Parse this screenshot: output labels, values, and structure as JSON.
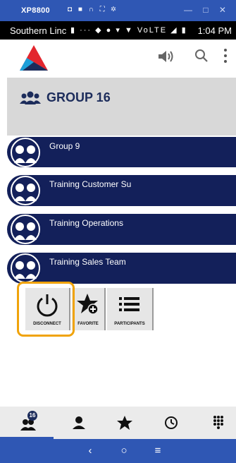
{
  "emulator": {
    "title": "XP8800",
    "icons": "◘ ■ ∩ ⛶ ✲",
    "controls": "— □ ✕"
  },
  "status_bar": {
    "carrier": "Southern Linc",
    "icons": "▮  ···  ◆ ● ▾ ▼ VoLTE ◢ ▮",
    "time": "1:04 PM"
  },
  "app_bar": {
    "icons": [
      "app-logo",
      "speaker-icon",
      "search-icon",
      "more-vert-icon"
    ]
  },
  "group": {
    "title": "GROUP 16"
  },
  "talkgroups": [
    {
      "label": "Group 9"
    },
    {
      "label": "Training Customer Su"
    },
    {
      "label": "Training Operations"
    },
    {
      "label": "Training Sales Team"
    }
  ],
  "actions": {
    "disconnect": "DISCONNECT",
    "favorite": "FAVORITE",
    "participants": "PARTICIPANTS"
  },
  "bottom_nav": {
    "groups_badge": "16",
    "items": [
      "groups-icon",
      "contact-icon",
      "favorites-icon",
      "history-icon",
      "dialpad-icon"
    ]
  },
  "system_nav": {
    "back": "‹",
    "home": "○",
    "recents": "≡"
  },
  "colors": {
    "accent": "#2f57b4",
    "navy": "#13205a",
    "highlight": "#f0a30a"
  }
}
